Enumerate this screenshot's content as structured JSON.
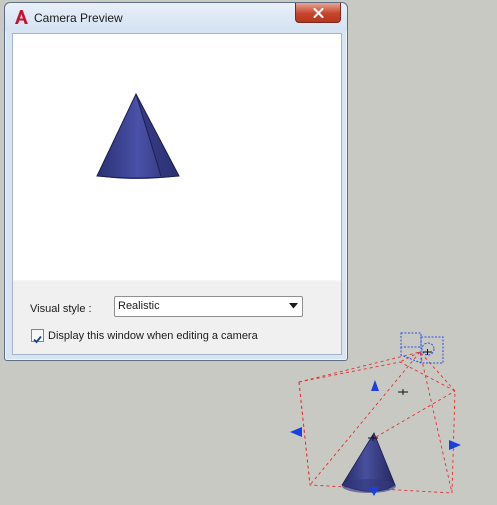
{
  "dialog": {
    "title": "Camera Preview",
    "close_icon": "close-icon",
    "app_icon": "autocad-logo-icon"
  },
  "preview": {
    "background": "#ffffff",
    "object": "cone"
  },
  "visual_style": {
    "label": "Visual style :",
    "value": "Realistic",
    "arrow_icon": "chevron-down-icon"
  },
  "option": {
    "label": "Display this window when editing a camera",
    "checked": true
  },
  "canvas": {
    "background": "#c9c9c4",
    "frustum_color": "#e03030",
    "grip_color": "#1a40e0",
    "camera_color": "#2a50e0",
    "cone_color": "#3a3f8c"
  }
}
